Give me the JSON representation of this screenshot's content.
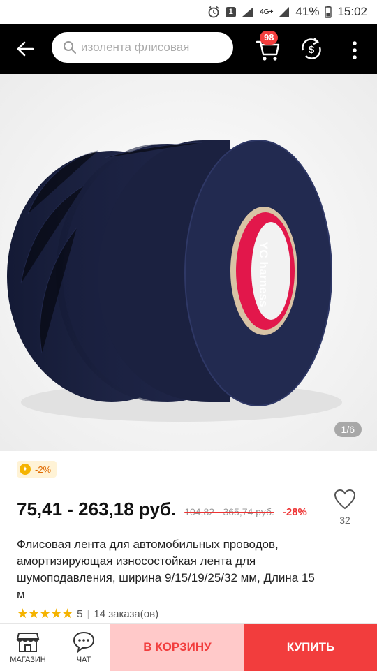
{
  "status_bar": {
    "notification_count": "1",
    "network": "4G+",
    "battery": "41%",
    "time": "15:02"
  },
  "search": {
    "placeholder": "изолента флисовая"
  },
  "cart": {
    "badge": "98"
  },
  "product": {
    "image_counter": "1/6",
    "discount_badge": "-2%",
    "price": "75,41 - 263,18 руб.",
    "old_price": "104,82 - 365,74 руб.",
    "discount_percent": "-28%",
    "wishlist_count": "32",
    "title": "Флисовая лента для автомобильных проводов, амортизирующая износостойкая лента для шумоподавления, ширина 9/15/19/25/32 мм, Длина 15 м",
    "rating_value": "5",
    "orders": "14 заказа(ов)",
    "tape_label": "YC harness"
  },
  "bottom_bar": {
    "store_label": "МАГАЗИН",
    "chat_label": "ЧАТ",
    "add_to_cart": "В КОРЗИНУ",
    "buy_now": "КУПИТЬ"
  },
  "colors": {
    "accent": "#f23d3d",
    "cart_button_bg": "#ffc9c9",
    "tape": "#1b2140",
    "star": "#f5b300"
  }
}
